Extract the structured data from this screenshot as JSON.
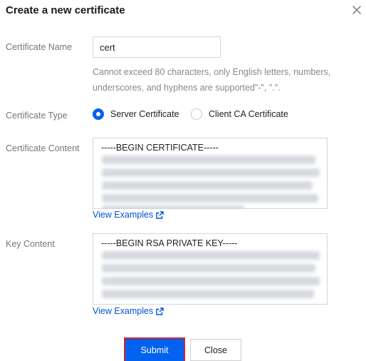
{
  "dialog": {
    "title": "Create a new certificate",
    "close_icon": "close-icon"
  },
  "form": {
    "name_label": "Certificate Name",
    "name_value": "cert",
    "name_hint": "Cannot exceed 80 characters, only English letters, numbers, underscores, and hyphens are supported\"-\", \".\".",
    "type_label": "Certificate Type",
    "type_options": [
      {
        "label": "Server Certificate",
        "selected": true
      },
      {
        "label": "Client CA Certificate",
        "selected": false
      }
    ],
    "content_label": "Certificate Content",
    "content_first_line": "-----BEGIN CERTIFICATE-----",
    "content_link": "View Examples",
    "key_label": "Key Content",
    "key_first_line": "-----BEGIN RSA PRIVATE KEY-----",
    "key_link": "View Examples"
  },
  "footer": {
    "submit_label": "Submit",
    "close_label": "Close"
  },
  "colors": {
    "accent": "#0062ee",
    "link": "#0052d9",
    "highlight_border": "#d9202c"
  }
}
